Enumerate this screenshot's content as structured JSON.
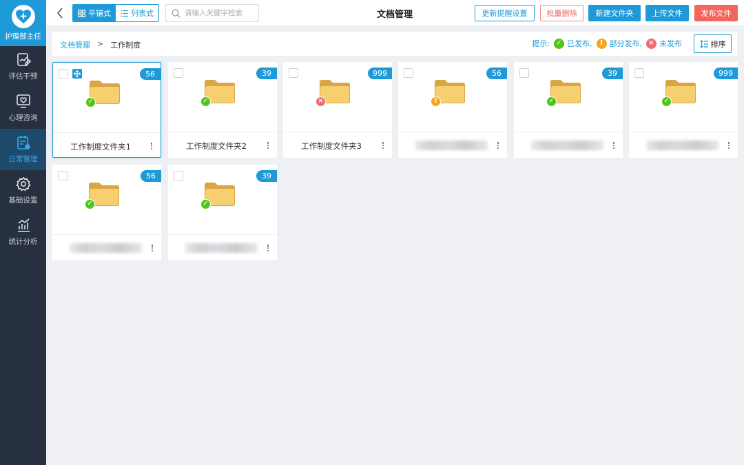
{
  "app": {
    "name": "护理部主任"
  },
  "sidebar": {
    "items": [
      {
        "label": "评估干预",
        "icon": "assessment-icon",
        "active": false
      },
      {
        "label": "心理咨询",
        "icon": "counseling-icon",
        "active": false
      },
      {
        "label": "日常管理",
        "icon": "daily-management-icon",
        "active": true
      },
      {
        "label": "基础设置",
        "icon": "settings-icon",
        "active": false
      },
      {
        "label": "统计分析",
        "icon": "statistics-icon",
        "active": false
      }
    ]
  },
  "toolbar": {
    "view_tile": "平铺式",
    "view_list": "列表式",
    "search_placeholder": "请输入关键字检索",
    "title": "文档管理",
    "update_reminder": "更新提醒设置",
    "batch_delete": "批量删除",
    "new_folder": "新建文件夹",
    "upload_file": "上传文件",
    "publish_file": "发布文件"
  },
  "breadcrumb": {
    "root": "文档管理",
    "separator": ">",
    "current": "工作制度"
  },
  "legend": {
    "prefix": "提示:",
    "published": "已发布,",
    "partial": "部分发布,",
    "unpublished": "未发布"
  },
  "sort_label": "排序",
  "folders": [
    {
      "count": "56",
      "name": "工作制度文件夹1",
      "status": "published",
      "selected": true
    },
    {
      "count": "39",
      "name": "工作制度文件夹2",
      "status": "published",
      "selected": false
    },
    {
      "count": "999",
      "name": "工作制度文件夹3",
      "status": "unpublished",
      "selected": false
    },
    {
      "count": "56",
      "name": "",
      "status": "partial",
      "selected": false
    },
    {
      "count": "39",
      "name": "",
      "status": "published",
      "selected": false
    },
    {
      "count": "999",
      "name": "",
      "status": "published",
      "selected": false
    },
    {
      "count": "56",
      "name": "",
      "status": "published",
      "selected": false
    },
    {
      "count": "39",
      "name": "",
      "status": "published",
      "selected": false
    }
  ],
  "colors": {
    "accent": "#1f9ad8",
    "published": "#52c41a",
    "partial": "#f5a623",
    "unpublished": "#f06a72",
    "danger": "#f2665b",
    "sidebar_bg": "#27303f"
  }
}
